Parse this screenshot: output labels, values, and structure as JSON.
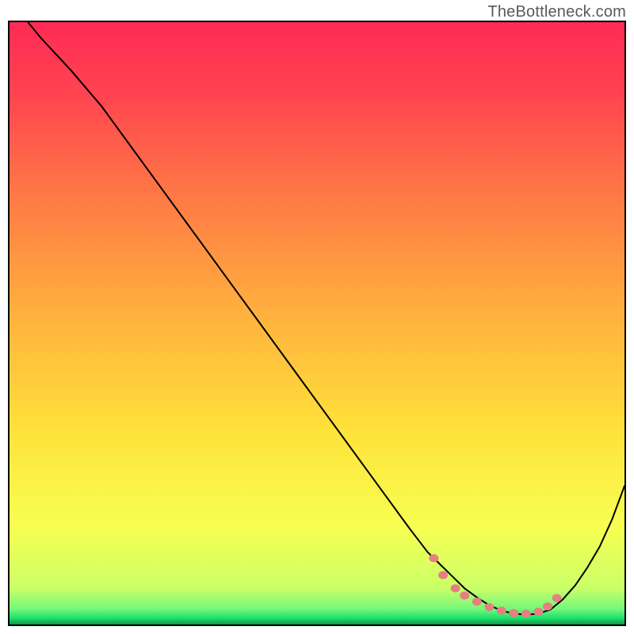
{
  "watermark": "TheBottleneck.com",
  "chart_data": {
    "type": "line",
    "title": "",
    "xlabel": "",
    "ylabel": "",
    "xlim": [
      0,
      100
    ],
    "ylim": [
      0,
      100
    ],
    "grid": false,
    "legend": false,
    "background": {
      "top_color": "#ff2b55",
      "mid_color": "#ffe23a",
      "bottom_green": "#16e06a",
      "bottom_edge": "#1c8f46"
    },
    "series": [
      {
        "name": "bottleneck-curve",
        "stroke": "#000000",
        "stroke_width": 2,
        "x": [
          0,
          3,
          5,
          10,
          15,
          20,
          25,
          30,
          35,
          40,
          45,
          50,
          55,
          60,
          65,
          68,
          70,
          72,
          74,
          76,
          78,
          80,
          82,
          84,
          86,
          88,
          90,
          92,
          94,
          96,
          98,
          100
        ],
        "y": [
          106,
          100,
          97.5,
          92,
          86,
          79,
          72,
          65,
          58,
          51,
          44,
          37,
          30,
          23,
          16,
          12,
          10,
          8,
          6,
          4.5,
          3.2,
          2.3,
          1.8,
          1.6,
          1.8,
          2.5,
          4.2,
          6.5,
          9.5,
          13,
          17.5,
          23
        ]
      }
    ],
    "markers": {
      "name": "optimum-band",
      "color": "#e68080",
      "radius": 6,
      "x": [
        69,
        70.5,
        72.5,
        74,
        76,
        78,
        80,
        82,
        84,
        86,
        87.5,
        89
      ],
      "y": [
        11,
        8.2,
        6,
        4.8,
        3.8,
        2.9,
        2.3,
        1.9,
        1.8,
        2.1,
        3.0,
        4.4
      ]
    }
  }
}
